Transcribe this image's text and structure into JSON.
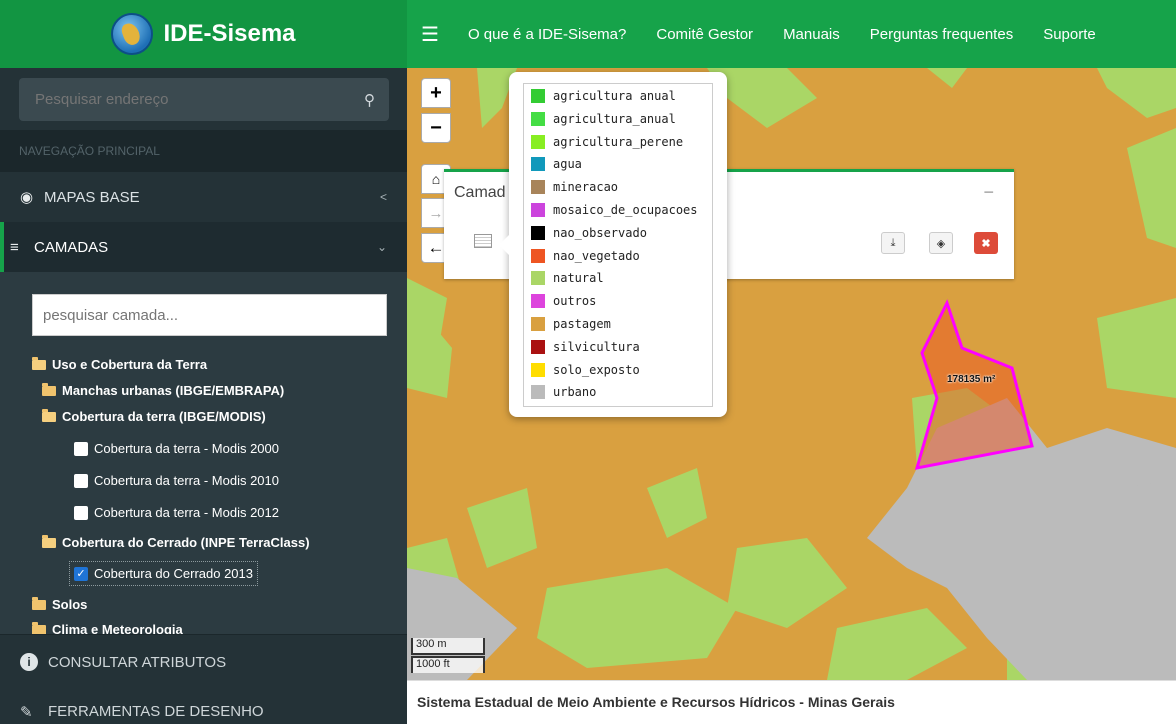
{
  "app": {
    "title": "IDE-Sisema"
  },
  "nav": {
    "menu_icon": "hamburger-icon",
    "links": [
      "O que é a IDE-Sisema?",
      "Comitê Gestor",
      "Manuais",
      "Perguntas frequentes",
      "Suporte"
    ]
  },
  "sidebar": {
    "search_placeholder": "Pesquisar endereço",
    "nav_header": "NAVEGAÇÃO PRINCIPAL",
    "mapas_base": "MAPAS BASE",
    "camadas": "CAMADAS",
    "layer_search_placeholder": "pesquisar camada...",
    "tree": {
      "uso": "Uso e Cobertura da Terra",
      "manchas": "Manchas urbanas (IBGE/EMBRAPA)",
      "cobertura": "Cobertura da terra (IBGE/MODIS)",
      "modis2000": "Cobertura da terra - Modis 2000",
      "modis2010": "Cobertura da terra - Modis 2010",
      "modis2012": "Cobertura da terra - Modis 2012",
      "cerrado": "Cobertura do Cerrado (INPE TerraClass)",
      "cerrado2013": "Cobertura do Cerrado 2013",
      "solos": "Solos",
      "clima": "Clima e Meteorologia"
    },
    "consultar": "CONSULTAR ATRIBUTOS",
    "ferramentas": "FERRAMENTAS DE DESENHO"
  },
  "map": {
    "zoom_in": "+",
    "zoom_out": "−",
    "panel_title": "Camad",
    "panel_minimize": "−",
    "scale_m": "300 m",
    "scale_ft": "1000 ft",
    "area_label": "178135 m²",
    "legend": [
      {
        "label": "agricultura anual",
        "color": "#33cc33"
      },
      {
        "label": "agricultura_anual",
        "color": "#44dd44"
      },
      {
        "label": "agricultura_perene",
        "color": "#88ee22"
      },
      {
        "label": "agua",
        "color": "#1199bb"
      },
      {
        "label": "mineracao",
        "color": "#a8845a"
      },
      {
        "label": "mosaico_de_ocupacoes",
        "color": "#cc44dd"
      },
      {
        "label": "nao_observado",
        "color": "#000000"
      },
      {
        "label": "nao_vegetado",
        "color": "#ee5522"
      },
      {
        "label": "natural",
        "color": "#aad666"
      },
      {
        "label": "outros",
        "color": "#dd44dd"
      },
      {
        "label": "pastagem",
        "color": "#d9a040"
      },
      {
        "label": "silvicultura",
        "color": "#aa1111"
      },
      {
        "label": "solo_exposto",
        "color": "#ffdd00"
      },
      {
        "label": "urbano",
        "color": "#bbbbbb"
      }
    ]
  },
  "footer": {
    "text": "Sistema Estadual de Meio Ambiente e Recursos Hídricos - Minas Gerais"
  }
}
